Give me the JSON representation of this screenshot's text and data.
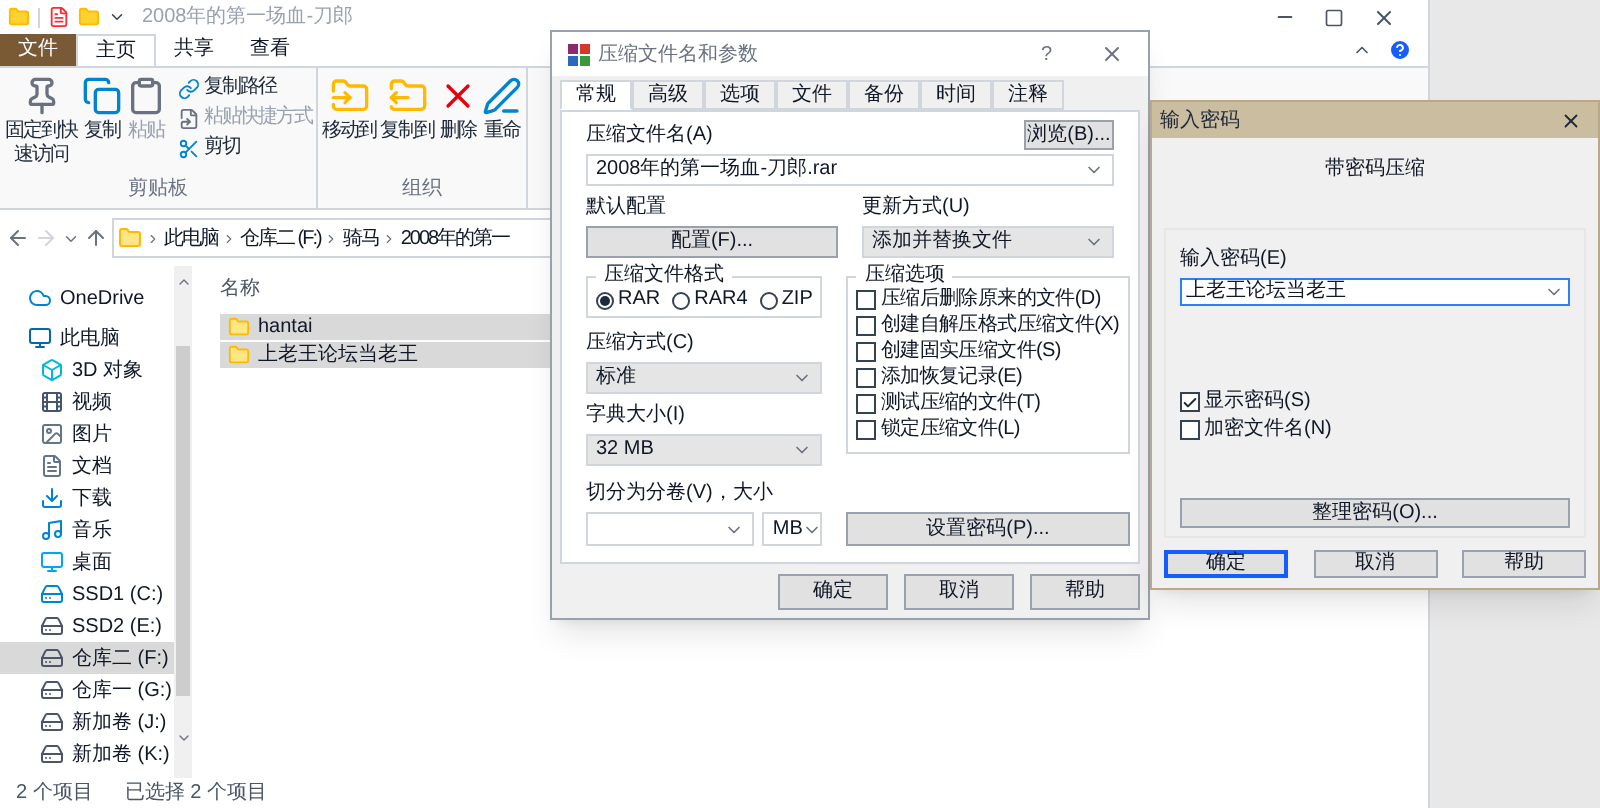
{
  "explorer": {
    "title": "2008年的第一场血-刀郎",
    "ribbon_tabs": [
      {
        "label": "文件",
        "kind": "file",
        "selected": false
      },
      {
        "label": "主页",
        "kind": "tab",
        "selected": true
      },
      {
        "label": "共享",
        "kind": "tab",
        "selected": false
      },
      {
        "label": "查看",
        "kind": "tab",
        "selected": false
      }
    ],
    "ribbon_groups": [
      {
        "label": "剪贴板",
        "large_items": [
          {
            "label": "固定到快速访问",
            "kind": "pin",
            "disabled": false
          },
          {
            "label": "复制",
            "kind": "copy",
            "disabled": false
          },
          {
            "label": "粘贴",
            "kind": "paste",
            "disabled": true
          }
        ],
        "small_items": [
          {
            "label": "复制路径",
            "kind": "path",
            "disabled": false
          },
          {
            "label": "粘贴快捷方式",
            "kind": "shortcut",
            "disabled": true
          },
          {
            "label": "剪切",
            "kind": "cut",
            "disabled": false
          }
        ]
      },
      {
        "label": "组织",
        "large_items": [
          {
            "label": "移动到",
            "kind": "move",
            "disabled": false
          },
          {
            "label": "复制到",
            "kind": "copyto",
            "disabled": false
          },
          {
            "label": "删除",
            "kind": "delete",
            "disabled": false
          },
          {
            "label": "重命",
            "kind": "rename",
            "disabled": false
          }
        ]
      }
    ],
    "address": [
      "此电脑",
      "仓库二 (F:)",
      "骑马",
      "2008年的第一"
    ],
    "sidebar": [
      {
        "label": "OneDrive",
        "kind": "cloud",
        "selected": false
      },
      {
        "label": "此电脑",
        "kind": "pc",
        "selected": false
      },
      {
        "label": "3D 对象",
        "kind": "cube",
        "selected": false
      },
      {
        "label": "视频",
        "kind": "video",
        "selected": false
      },
      {
        "label": "图片",
        "kind": "image",
        "selected": false
      },
      {
        "label": "文档",
        "kind": "doc",
        "selected": false
      },
      {
        "label": "下载",
        "kind": "download",
        "selected": false
      },
      {
        "label": "音乐",
        "kind": "music",
        "selected": false
      },
      {
        "label": "桌面",
        "kind": "desktop",
        "selected": false
      },
      {
        "label": "SSD1 (C:)",
        "kind": "sysdrive",
        "selected": false
      },
      {
        "label": "SSD2 (E:)",
        "kind": "drive",
        "selected": false
      },
      {
        "label": "仓库二 (F:)",
        "kind": "drive",
        "selected": true
      },
      {
        "label": "仓库一 (G:)",
        "kind": "drive",
        "selected": false
      },
      {
        "label": "新加卷 (J:)",
        "kind": "drive",
        "selected": false
      },
      {
        "label": "新加卷 (K:)",
        "kind": "drive",
        "selected": false
      }
    ],
    "column": "名称",
    "files": [
      {
        "name": "hantai",
        "selected": true
      },
      {
        "name": "上老王论坛当老王",
        "selected": true
      }
    ],
    "status": [
      "2 个项目",
      "已选择 2 个项目"
    ]
  },
  "archive_dialog": {
    "title": "压缩文件名和参数",
    "help": "?",
    "tabs": [
      {
        "label": "常规",
        "selected": true
      },
      {
        "label": "高级",
        "selected": false
      },
      {
        "label": "选项",
        "selected": false
      },
      {
        "label": "文件",
        "selected": false
      },
      {
        "label": "备份",
        "selected": false
      },
      {
        "label": "时间",
        "selected": false
      },
      {
        "label": "注释",
        "selected": false
      }
    ],
    "archive_label": "压缩文件名(A)",
    "browse": "浏览(B)...",
    "archive_name": "2008年的第一场血-刀郎.rar",
    "profile_label": "默认配置",
    "profile_button": "配置(F)...",
    "update_label": "更新方式(U)",
    "update_value": "添加并替换文件",
    "format_title": "压缩文件格式",
    "formats": [
      {
        "label": "RAR",
        "selected": true
      },
      {
        "label": "RAR4",
        "selected": false
      },
      {
        "label": "ZIP",
        "selected": false
      }
    ],
    "method_label": "压缩方式(C)",
    "method_value": "标准",
    "dict_label": "字典大小(I)",
    "dict_value": "32 MB",
    "split_label": "切分为分卷(V)，大小",
    "split_unit": "MB",
    "options_title": "压缩选项",
    "options": [
      {
        "label": "压缩后删除原来的文件(D)",
        "checked": false
      },
      {
        "label": "创建自解压格式压缩文件(X)",
        "checked": false
      },
      {
        "label": "创建固实压缩文件(S)",
        "checked": false
      },
      {
        "label": "添加恢复记录(E)",
        "checked": false
      },
      {
        "label": "测试压缩的文件(T)",
        "checked": false
      },
      {
        "label": "锁定压缩文件(L)",
        "checked": false
      }
    ],
    "password_button": "设置密码(P)...",
    "buttons": [
      "确定",
      "取消",
      "帮助"
    ]
  },
  "password_dialog": {
    "title": "输入密码",
    "heading": "带密码压缩",
    "label": "输入密码(E)",
    "value": "上老王论坛当老王",
    "options": [
      {
        "label": "显示密码(S)",
        "checked": true
      },
      {
        "label": "加密文件名(N)",
        "checked": false
      }
    ],
    "organize_button": "整理密码(O)...",
    "buttons": [
      {
        "label": "确定",
        "focused": true
      },
      {
        "label": "取消",
        "focused": false
      },
      {
        "label": "帮助",
        "focused": false
      }
    ]
  }
}
